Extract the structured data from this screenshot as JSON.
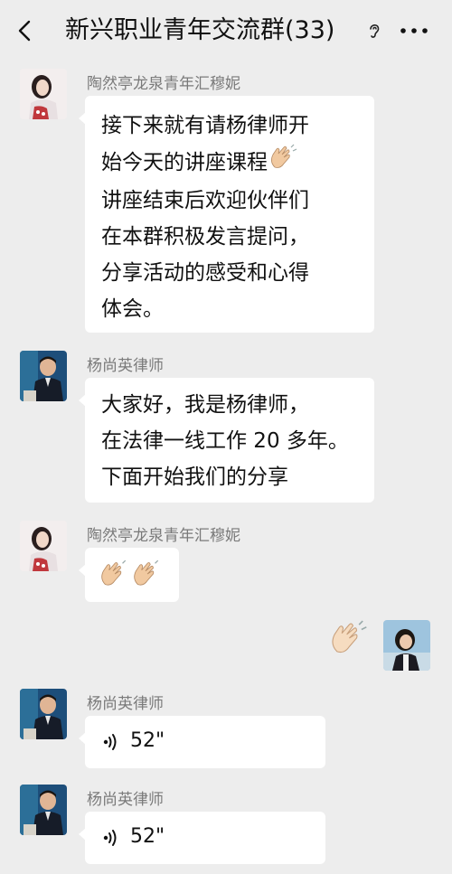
{
  "header": {
    "title": "新兴职业青年交流群(33)",
    "back_icon": "chevron-left-icon",
    "mute_icon": "ear-icon",
    "more_icon": "more-dots-icon"
  },
  "messages": [
    {
      "sender": "陶然亭龙泉青年汇穆妮",
      "lines": [
        "接下来就有请杨律师开",
        "始今天的讲座课程",
        "讲座结束后欢迎伙伴们",
        "在本群积极发言提问，",
        "分享活动的感受和心得",
        "体会。"
      ],
      "emoji": "clapping-hands-icon"
    },
    {
      "sender": "杨尚英律师",
      "lines": [
        "大家好，我是杨律师，",
        "在法律一线工作 20 多年。",
        "下面开始我们的分享"
      ]
    },
    {
      "sender": "陶然亭龙泉青年汇穆妮",
      "emoji": "clapping-hands-icon"
    },
    {
      "sender": "self",
      "emoji": "clapping-hands-icon"
    },
    {
      "sender": "杨尚英律师",
      "voice_duration": "52\""
    },
    {
      "sender": "杨尚英律师",
      "voice_duration": "52\""
    }
  ],
  "colors": {
    "background": "#ededed",
    "bubble": "#ffffff",
    "sender_text": "#7a7a7a"
  }
}
